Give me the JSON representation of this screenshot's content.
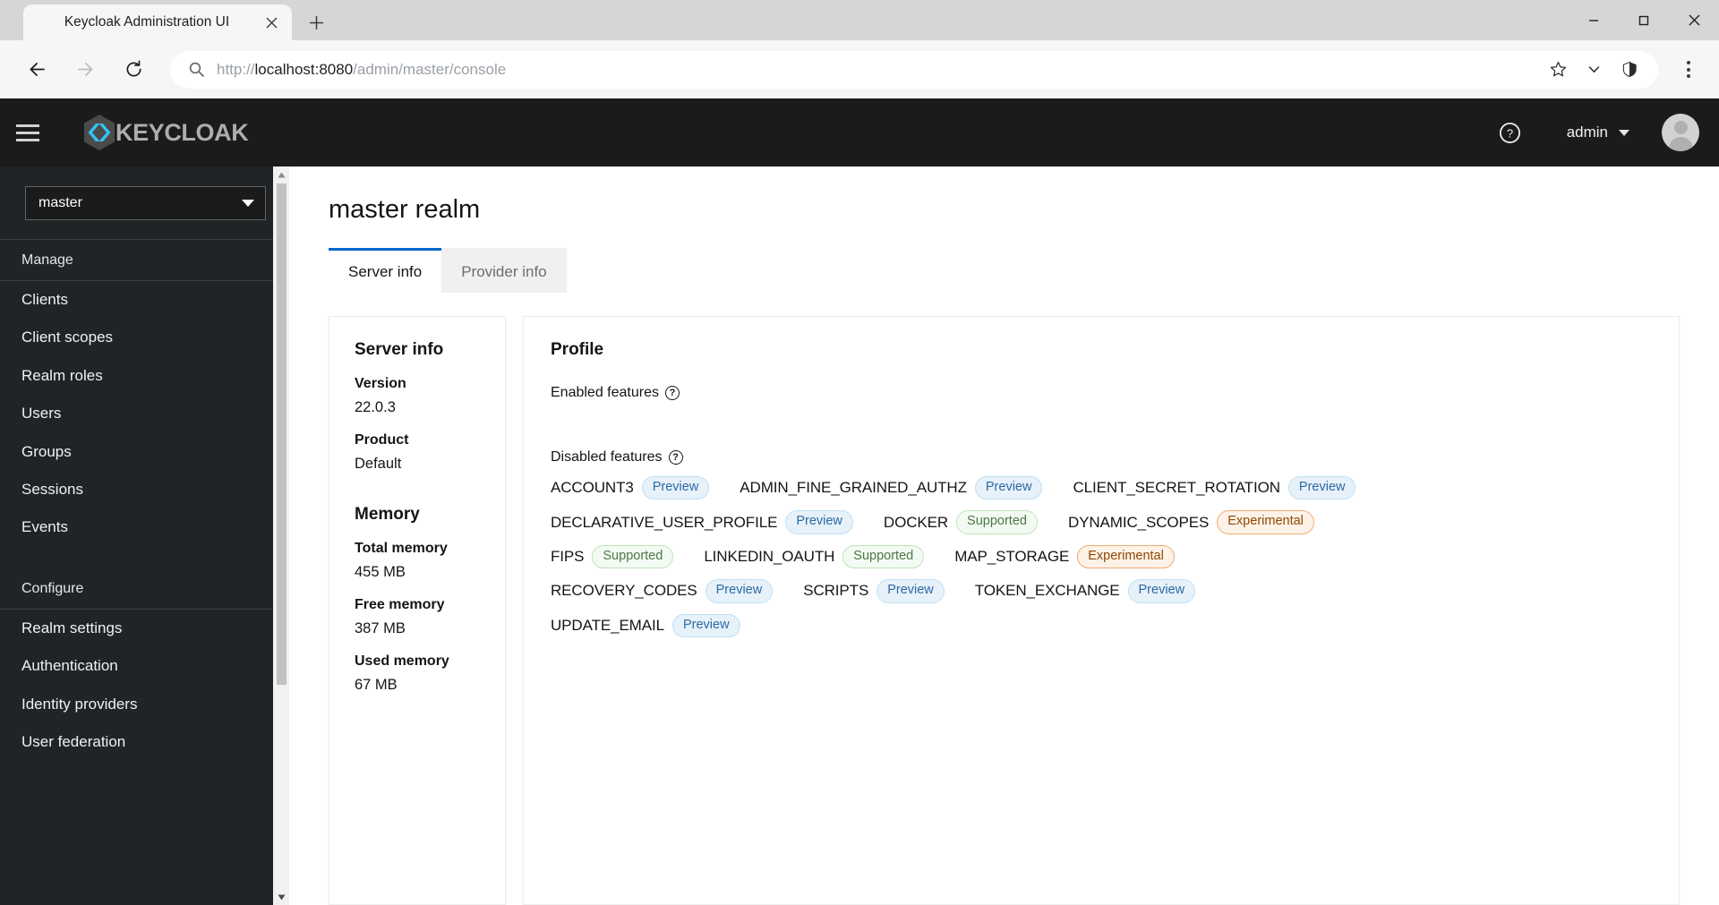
{
  "browser": {
    "tab_title": "Keycloak Administration UI",
    "tab_close_icon": "close-icon",
    "new_tab_icon": "plus-icon",
    "window_controls": {
      "minimize": "minimize-icon",
      "maximize": "maximize-icon",
      "close": "close-icon"
    },
    "nav": {
      "back": "back-arrow-icon",
      "forward": "forward-arrow-icon",
      "reload": "reload-icon"
    },
    "omnibox": {
      "search_icon": "search-icon",
      "url_scheme": "http://",
      "url_host": "localhost:8080",
      "url_path": "/admin/master/console",
      "full_url": "http://localhost:8080/admin/master/console",
      "bookmark_icon": "star-icon",
      "chevron_icon": "chevron-down-icon",
      "shield_icon": "shield-icon"
    },
    "menu_icon": "kebab-menu-icon"
  },
  "header": {
    "hamburger_icon": "hamburger-menu-icon",
    "brand": "KEYCLOAK",
    "brand_logo_icon": "keycloak-logo-icon",
    "help_icon": "help-circle-icon",
    "user_name": "admin",
    "caret_icon": "caret-down-icon",
    "avatar_icon": "user-avatar-icon",
    "accent_color": "#33c2ef"
  },
  "sidebar": {
    "realm_selector": {
      "value": "master",
      "caret_icon": "caret-down-icon"
    },
    "sections": [
      {
        "label": "Manage",
        "items": [
          {
            "label": "Clients"
          },
          {
            "label": "Client scopes"
          },
          {
            "label": "Realm roles"
          },
          {
            "label": "Users"
          },
          {
            "label": "Groups"
          },
          {
            "label": "Sessions"
          },
          {
            "label": "Events"
          }
        ]
      },
      {
        "label": "Configure",
        "items": [
          {
            "label": "Realm settings"
          },
          {
            "label": "Authentication"
          },
          {
            "label": "Identity providers"
          },
          {
            "label": "User federation"
          }
        ]
      }
    ],
    "scrollbar": {
      "up_icon": "scroll-up-arrow-icon",
      "down_icon": "scroll-down-arrow-icon"
    }
  },
  "main": {
    "page_title": "master realm",
    "tabs": [
      {
        "label": "Server info",
        "active": true
      },
      {
        "label": "Provider info",
        "active": false
      }
    ],
    "server_info": {
      "heading": "Server info",
      "rows": [
        {
          "term": "Version",
          "value": "22.0.3"
        },
        {
          "term": "Product",
          "value": "Default"
        }
      ],
      "memory_heading": "Memory",
      "memory_rows": [
        {
          "term": "Total memory",
          "value": "455 MB"
        },
        {
          "term": "Free memory",
          "value": "387 MB"
        },
        {
          "term": "Used memory",
          "value": "67 MB"
        }
      ]
    },
    "profile": {
      "heading": "Profile",
      "enabled_label": "Enabled features",
      "disabled_label": "Disabled features",
      "help_icon": "help-circle-icon",
      "enabled_features": [],
      "disabled_features": [
        {
          "name": "ACCOUNT3",
          "badge": "Preview",
          "badge_type": "preview"
        },
        {
          "name": "ADMIN_FINE_GRAINED_AUTHZ",
          "badge": "Preview",
          "badge_type": "preview"
        },
        {
          "name": "CLIENT_SECRET_ROTATION",
          "badge": "Preview",
          "badge_type": "preview"
        },
        {
          "name": "DECLARATIVE_USER_PROFILE",
          "badge": "Preview",
          "badge_type": "preview"
        },
        {
          "name": "DOCKER",
          "badge": "Supported",
          "badge_type": "supported"
        },
        {
          "name": "DYNAMIC_SCOPES",
          "badge": "Experimental",
          "badge_type": "experimental"
        },
        {
          "name": "FIPS",
          "badge": "Supported",
          "badge_type": "supported"
        },
        {
          "name": "LINKEDIN_OAUTH",
          "badge": "Supported",
          "badge_type": "supported"
        },
        {
          "name": "MAP_STORAGE",
          "badge": "Experimental",
          "badge_type": "experimental"
        },
        {
          "name": "RECOVERY_CODES",
          "badge": "Preview",
          "badge_type": "preview"
        },
        {
          "name": "SCRIPTS",
          "badge": "Preview",
          "badge_type": "preview"
        },
        {
          "name": "TOKEN_EXCHANGE",
          "badge": "Preview",
          "badge_type": "preview"
        },
        {
          "name": "UPDATE_EMAIL",
          "badge": "Preview",
          "badge_type": "preview"
        }
      ]
    }
  },
  "colors": {
    "header_bg": "#1b1b1b",
    "sidebar_bg": "#212427",
    "active_tab_border": "#0066cc",
    "preview_badge": "#e7f1fa",
    "supported_badge": "#f3faf3",
    "experimental_badge": "#fdf2e7"
  }
}
